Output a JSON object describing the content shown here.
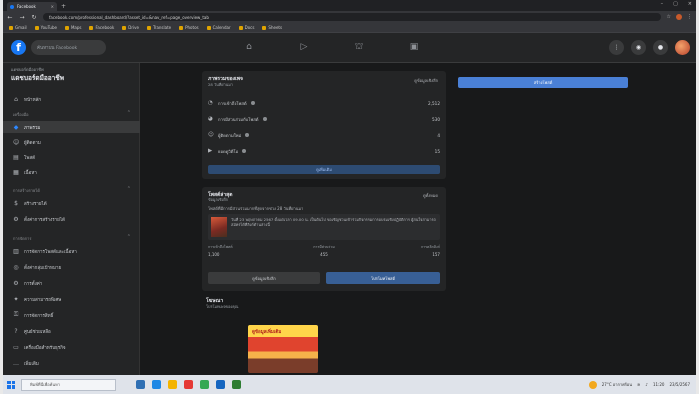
{
  "browser": {
    "tab_title": "Facebook",
    "url": "facebook.com/professional_dashboard/?asset_id=&nav_ref=page_overview_tab",
    "bookmarks": [
      "Gmail",
      "YouTube",
      "Maps",
      "Facebook",
      "Drive",
      "Translate",
      "Photos",
      "Calendar",
      "Docs",
      "Sheets"
    ]
  },
  "fb": {
    "logo": "f",
    "search_placeholder": "ค้นหาบน Facebook"
  },
  "sidebar": {
    "breadcrumb": "แดชบอร์ดมืออาชีพ",
    "title": "แดชบอร์ดมืออาชีพ",
    "home": "หน้าหลัก",
    "section_tools": "เครื่องมือ",
    "items": [
      "ภาพรวม",
      "ผู้ติดตาม",
      "โพสต์",
      "เนื้อหา"
    ],
    "section_monet": "การสร้างรายได้",
    "monet_items": [
      "สร้างรายได้",
      "ตั้งค่าการสร้างรายได้"
    ],
    "section_manage": "การจัดการ",
    "manage_items": [
      "การจัดการโพสต์และเนื้อหา",
      "ตั้งค่ากลุ่มเป้าหมาย",
      "การตั้งค่า",
      "ความสามารถพิเศษ",
      "การจัดการสิทธิ์",
      "ศูนย์ช่วยเหลือ",
      "เครื่องมือสำหรับธุรกิจ",
      "เพิ่มเติม"
    ]
  },
  "card_overview": {
    "title": "ภาพรวมของเพจ",
    "subtitle": "28 วันที่ผ่านมา",
    "link": "ดูข้อมูลเชิงลึก",
    "stats": [
      {
        "label": "การเข้าถึงโพสต์",
        "value": "2,512"
      },
      {
        "label": "การมีส่วนร่วมกับโพสต์",
        "value": "530"
      },
      {
        "label": "ผู้ติดตามใหม่",
        "value": "4"
      },
      {
        "label": "ยอดดูวิดีโอ",
        "value": "15"
      }
    ],
    "button": "ดูเพิ่มเติม",
    "cta": "สร้างโพสต์"
  },
  "card_posts": {
    "title": "โพสต์ล่าสุด",
    "subtitle": "ข้อมูลเชิงลึก",
    "link": "ดูทั้งหมด",
    "desc": "โพสต์ที่มีการมีส่วนร่วมมากที่สุดจากช่วง 28 วันที่ผ่านมา",
    "post_text": "วันที่ 23 พฤษภาคม 2567 ตั้งแต่เวลา 09.00 น. เป็นต้นไป ขอเชิญชวนเข้าร่วมกิจกรรมการอบรมเชิงปฏิบัติการ ผู้สนใจสามารถสมัครได้ที่ลิงก์ด้านล่างนี้",
    "metrics": [
      {
        "label": "การเข้าถึงโพสต์",
        "value": "1,100"
      },
      {
        "label": "การมีส่วนร่วม",
        "value": "455"
      },
      {
        "label": "การคลิกลิงก์",
        "value": "157"
      }
    ],
    "btn_left": "ดูข้อมูลเชิงลึก",
    "btn_right": "โปรโมทโพสต์"
  },
  "card_ads": {
    "title": "โฆษณา",
    "subtitle": "โปรโมทเพจของคุณ",
    "promo_text": "ดูข้อมูลเพิ่มเติม"
  },
  "taskbar": {
    "search": "พิมพ์ที่นี่เพื่อค้นหา",
    "weather": "27°C อากาศร้อน",
    "time": "11:20",
    "date": "23/5/2567"
  }
}
